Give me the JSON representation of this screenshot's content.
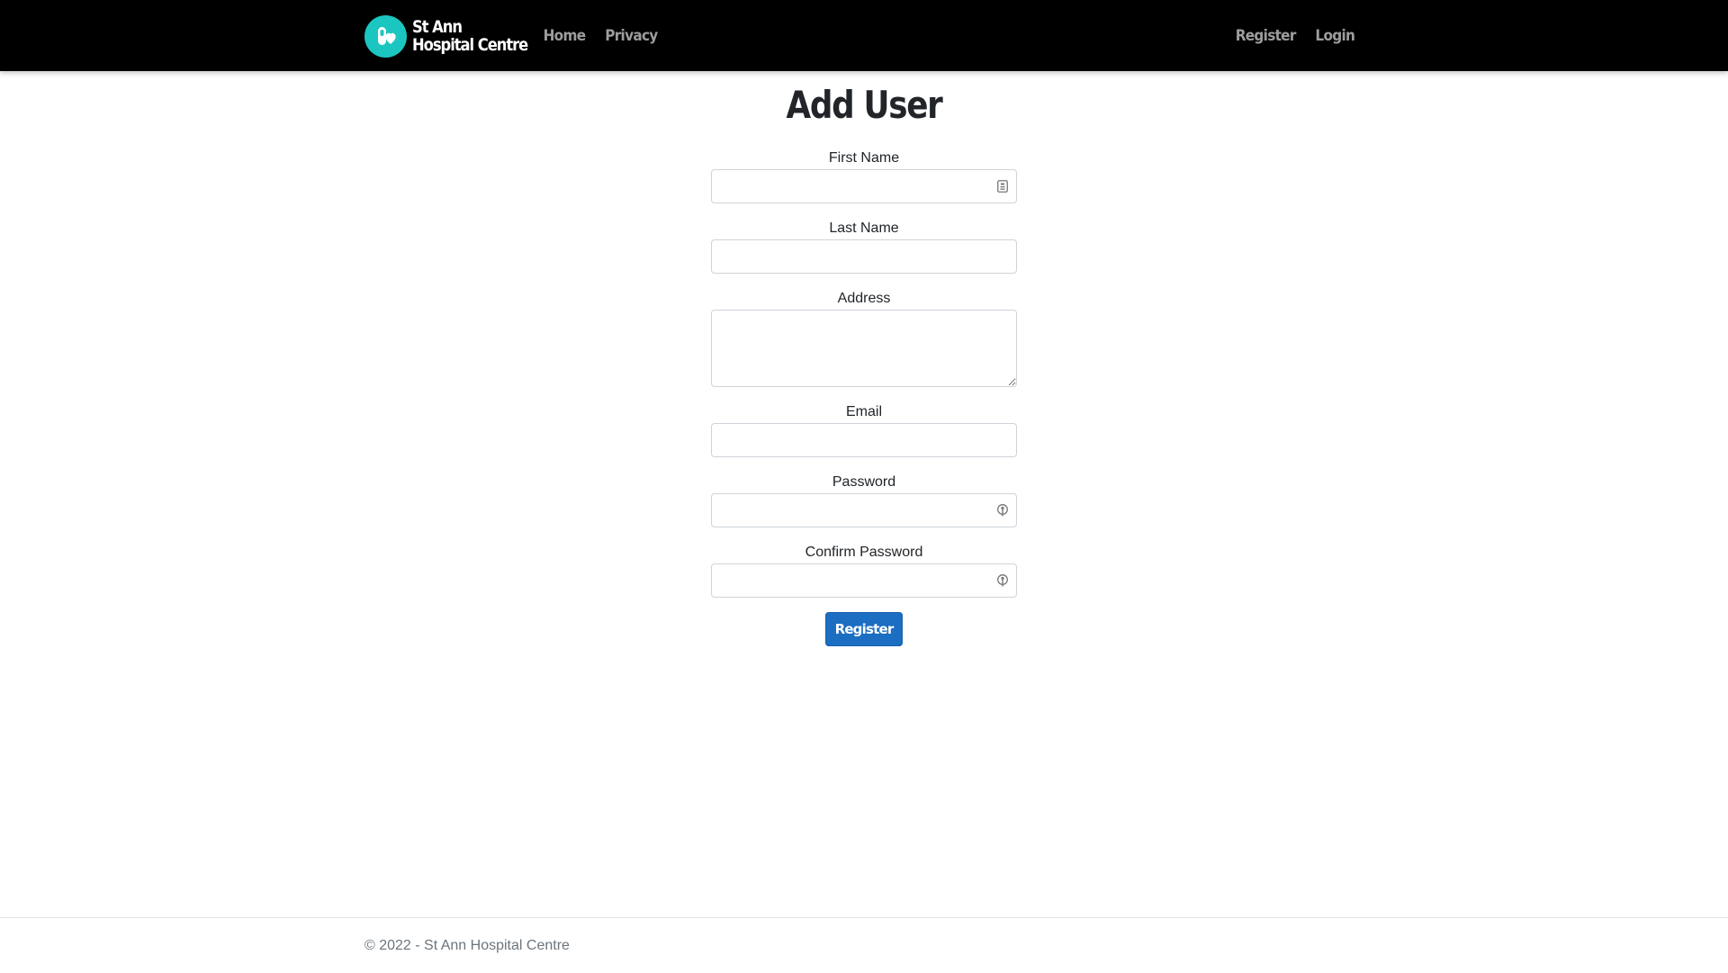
{
  "navbar": {
    "brand_line1": "St Ann",
    "brand_line2": "Hospital Centre",
    "links_left": [
      {
        "label": "Home"
      },
      {
        "label": "Privacy"
      }
    ],
    "links_right": [
      {
        "label": "Register"
      },
      {
        "label": "Login"
      }
    ],
    "colors": {
      "background": "#000000",
      "link": "#9d9d9d",
      "logo": "#1cc6c0"
    }
  },
  "main": {
    "title": "Add User",
    "fields": {
      "first_name": {
        "label": "First Name",
        "value": ""
      },
      "last_name": {
        "label": "Last Name",
        "value": ""
      },
      "address": {
        "label": "Address",
        "value": ""
      },
      "email": {
        "label": "Email",
        "value": ""
      },
      "password": {
        "label": "Password",
        "value": ""
      },
      "confirm_password": {
        "label": "Confirm Password",
        "value": ""
      }
    },
    "submit_label": "Register",
    "colors": {
      "primary": "#1b6ec2"
    }
  },
  "footer": {
    "text": "© 2022 - St Ann Hospital Centre"
  }
}
